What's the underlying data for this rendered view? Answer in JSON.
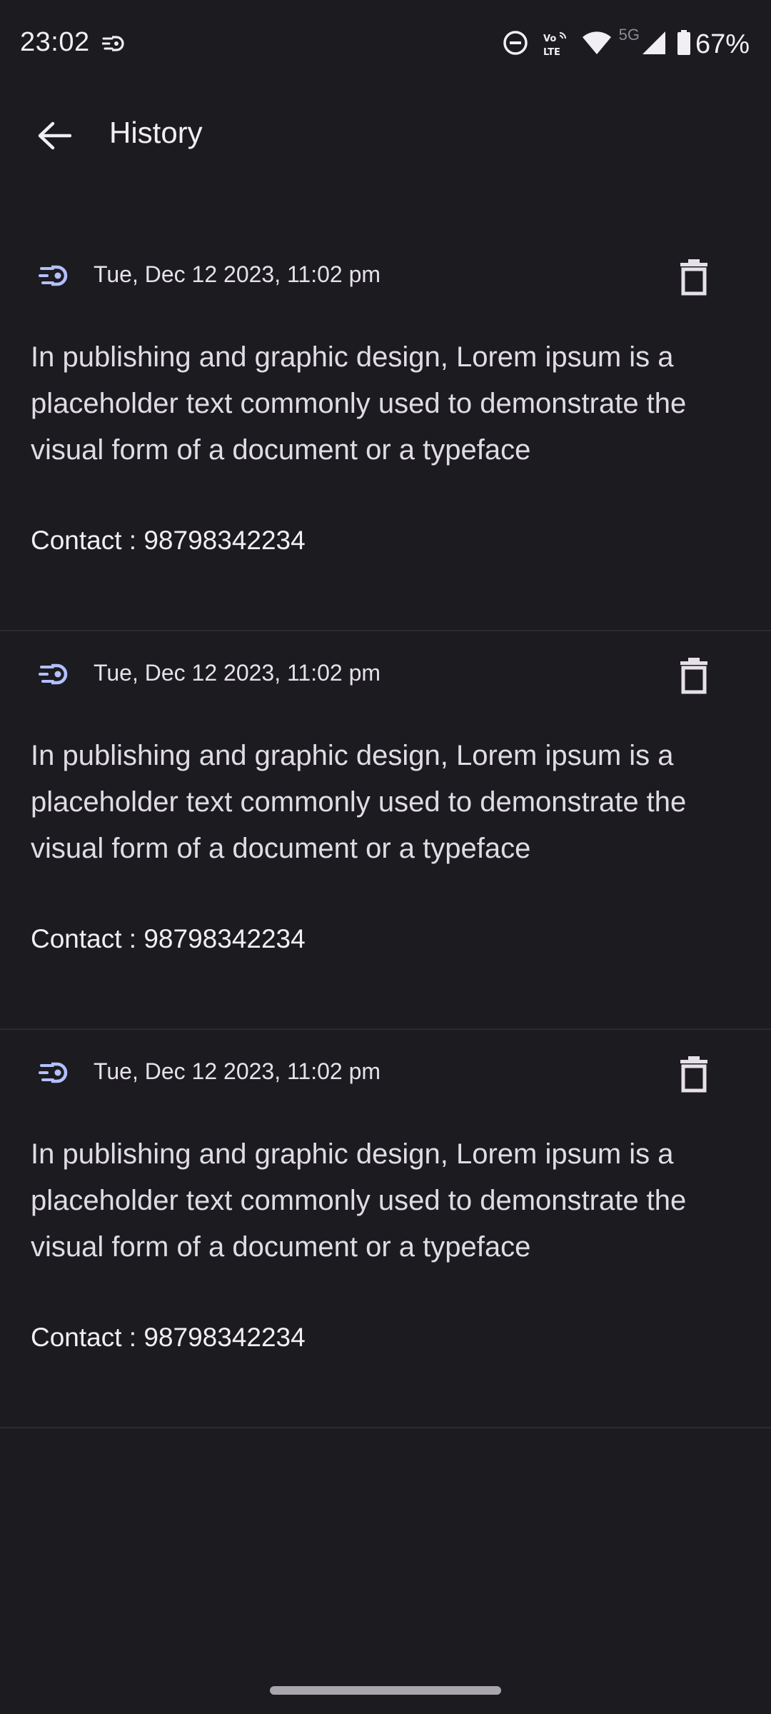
{
  "status_bar": {
    "time": "23:02",
    "network_label": "5G",
    "volte_label": "Vo LTE",
    "battery": "67%",
    "icons": [
      "data-saver-icon",
      "do-not-disturb-icon",
      "volte-icon",
      "wifi-icon",
      "signal-icon",
      "battery-icon"
    ]
  },
  "app_bar": {
    "title": "History",
    "back_icon": "arrow-back-icon"
  },
  "history": {
    "items": [
      {
        "date": "Tue, Dec 12 2023, 11:02 pm",
        "description": "In publishing and graphic design, Lorem ipsum is a placeholder text commonly used to demonstrate the visual form of a document or a typeface",
        "contact": "Contact : 98798342234"
      },
      {
        "date": "Tue, Dec 12 2023, 11:02 pm",
        "description": "In publishing and graphic design, Lorem ipsum is a placeholder text commonly used to demonstrate the visual form of a document or a typeface",
        "contact": "Contact : 98798342234"
      },
      {
        "date": "Tue, Dec 12 2023, 11:02 pm",
        "description": "In publishing and graphic design, Lorem ipsum is a placeholder text commonly used to demonstrate the visual form of a document or a typeface",
        "contact": "Contact : 98798342234"
      }
    ]
  },
  "colors": {
    "background": "#1c1b20",
    "accent": "#b3c0ff",
    "text": "#e6e1e9",
    "divider": "#2b2a30"
  }
}
